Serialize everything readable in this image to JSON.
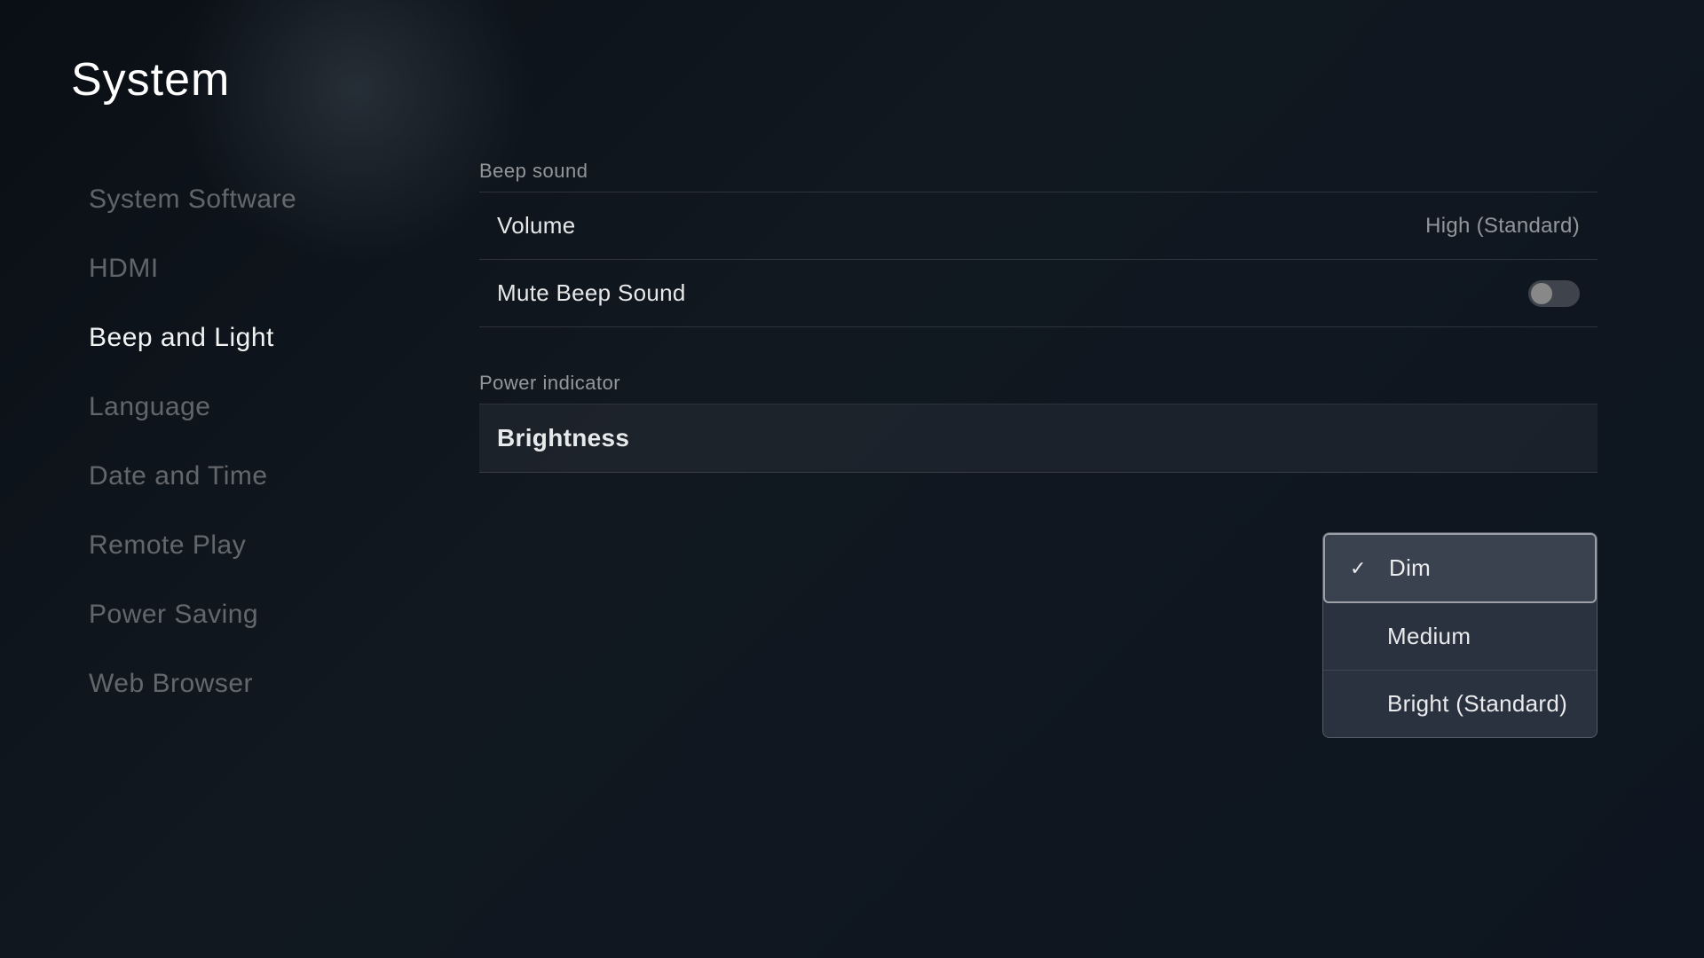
{
  "page": {
    "title": "System"
  },
  "sidebar": {
    "items": [
      {
        "id": "system-software",
        "label": "System Software",
        "active": false
      },
      {
        "id": "hdmi",
        "label": "HDMI",
        "active": false
      },
      {
        "id": "beep-and-light",
        "label": "Beep and Light",
        "active": true
      },
      {
        "id": "language",
        "label": "Language",
        "active": false
      },
      {
        "id": "date-and-time",
        "label": "Date and Time",
        "active": false
      },
      {
        "id": "remote-play",
        "label": "Remote Play",
        "active": false
      },
      {
        "id": "power-saving",
        "label": "Power Saving",
        "active": false
      },
      {
        "id": "web-browser",
        "label": "Web Browser",
        "active": false
      }
    ]
  },
  "content": {
    "sections": [
      {
        "id": "beep-sound",
        "label": "Beep sound",
        "settings": [
          {
            "id": "volume",
            "name": "Volume",
            "value": "High (Standard)",
            "type": "value"
          },
          {
            "id": "mute-beep-sound",
            "name": "Mute Beep Sound",
            "value": "",
            "type": "toggle",
            "toggled": false
          }
        ]
      },
      {
        "id": "power-indicator",
        "label": "Power indicator",
        "settings": [
          {
            "id": "brightness",
            "name": "Brightness",
            "value": "",
            "type": "dropdown-trigger"
          }
        ]
      }
    ]
  },
  "dropdown": {
    "items": [
      {
        "id": "dim",
        "label": "Dim",
        "selected": true
      },
      {
        "id": "medium",
        "label": "Medium",
        "selected": false
      },
      {
        "id": "bright-standard",
        "label": "Bright (Standard)",
        "selected": false
      }
    ]
  }
}
